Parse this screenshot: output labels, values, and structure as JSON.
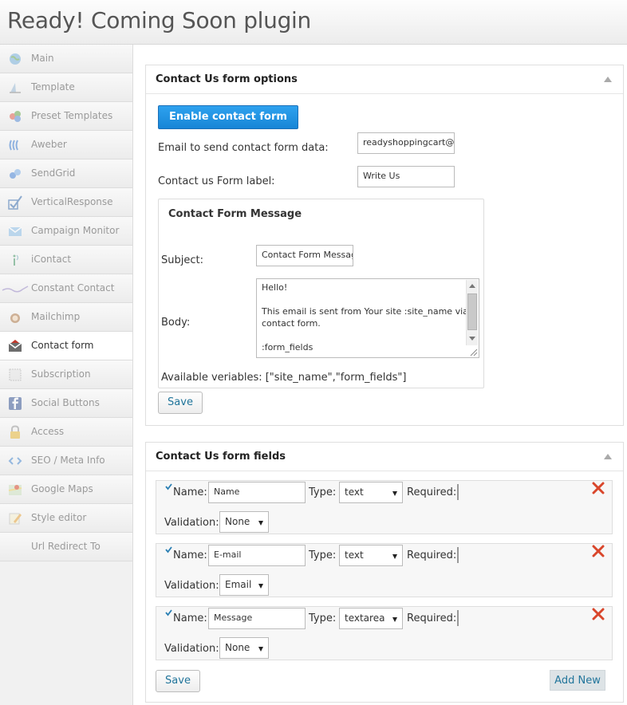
{
  "header": {
    "title": "Ready! Coming Soon plugin"
  },
  "sidebar": {
    "items": [
      {
        "label": "Main",
        "icon": "globe-icon"
      },
      {
        "label": "Template",
        "icon": "ruler-icon"
      },
      {
        "label": "Preset Templates",
        "icon": "palette-icon"
      },
      {
        "label": "Aweber",
        "icon": "aweber-icon"
      },
      {
        "label": "SendGrid",
        "icon": "sendgrid-icon"
      },
      {
        "label": "VerticalResponse",
        "icon": "checkmark-icon"
      },
      {
        "label": "Campaign Monitor",
        "icon": "envelope-icon"
      },
      {
        "label": "iContact",
        "icon": "icontact-icon"
      },
      {
        "label": "Constant Contact",
        "icon": "constant-contact-icon"
      },
      {
        "label": "Mailchimp",
        "icon": "mailchimp-icon"
      },
      {
        "label": "Contact form",
        "icon": "mail-icon",
        "active": true
      },
      {
        "label": "Subscription",
        "icon": "subscription-icon"
      },
      {
        "label": "Social Buttons",
        "icon": "facebook-icon"
      },
      {
        "label": "Access",
        "icon": "lock-icon"
      },
      {
        "label": "SEO / Meta Info",
        "icon": "code-icon"
      },
      {
        "label": "Google Maps",
        "icon": "map-icon"
      },
      {
        "label": "Style editor",
        "icon": "pencil-icon"
      },
      {
        "label": "Url Redirect To",
        "icon": ""
      }
    ]
  },
  "options_panel": {
    "title": "Contact Us form options",
    "enable_button": "Enable contact form",
    "email_label": "Email to send contact form data:",
    "email_value": "readyshoppingcart@g",
    "form_label_label": "Contact us Form label:",
    "form_label_value": "Write Us",
    "message": {
      "title": "Contact Form Message",
      "subject_label": "Subject:",
      "subject_value": "Contact Form Messag",
      "body_label": "Body:",
      "body_lines": [
        "Hello!",
        "",
        "This email is sent from Your site :site_name via",
        "contact form.",
        "",
        ":form_fields"
      ],
      "variables_text": "Available veriables: [\"site_name\",\"form_fields\"]"
    },
    "save_label": "Save"
  },
  "fields_panel": {
    "title": "Contact Us form fields",
    "name_label": "Name:",
    "type_label": "Type:",
    "required_label": "Required:",
    "validation_label": "Validation:",
    "fields": [
      {
        "name": "Name",
        "type": "text",
        "validation": "None"
      },
      {
        "name": "E-mail",
        "type": "text",
        "validation": "Email"
      },
      {
        "name": "Message",
        "type": "textarea",
        "validation": "None"
      }
    ],
    "save_label": "Save",
    "add_new_label": "Add New"
  },
  "colors": {
    "accent": "#1e8fe3",
    "link": "#21759b",
    "delete": "#d9462b",
    "check": "#2a7fb3"
  }
}
